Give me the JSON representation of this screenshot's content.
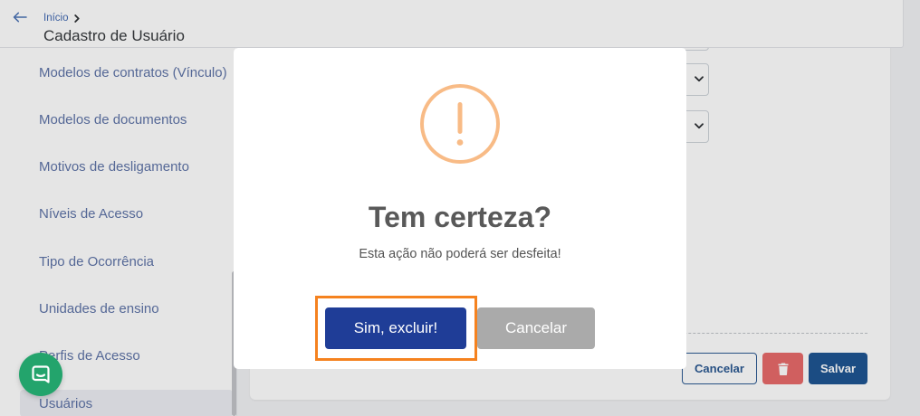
{
  "header": {
    "breadcrumb": {
      "home_label": "Início"
    },
    "title": "Cadastro de Usuário"
  },
  "sidebar": {
    "items": [
      {
        "label": "Modelos de contratos (Vínculo)"
      },
      {
        "label": "Modelos de documentos"
      },
      {
        "label": "Motivos de desligamento"
      },
      {
        "label": "Níveis de Acesso"
      },
      {
        "label": "Tipo de Ocorrência"
      },
      {
        "label": "Unidades de ensino"
      },
      {
        "label": "Perfis de Acesso"
      },
      {
        "label": "Usuários",
        "active": true
      }
    ]
  },
  "form": {
    "actions": {
      "cancel_label": "Cancelar",
      "save_label": "Salvar"
    }
  },
  "modal": {
    "title": "Tem certeza?",
    "message": "Esta ação não poderá ser desfeita!",
    "confirm_label": "Sim, excluir!",
    "cancel_label": "Cancelar"
  },
  "icons": {
    "back": "arrow-left-icon",
    "breadcrumb_separator": "chevron-right-icon",
    "select_toggle": "chevron-down-icon",
    "delete": "trash-icon",
    "modal": "warning-icon",
    "chat": "chat-icon"
  },
  "colors": {
    "primary": "#1f3d97",
    "secondary": "#aaaaaa",
    "warning": "#f8bb86",
    "save": "#1f5592",
    "danger": "#e86a6a",
    "chat": "#23a46c",
    "highlight": "#f5821f",
    "link": "#4269b2"
  }
}
